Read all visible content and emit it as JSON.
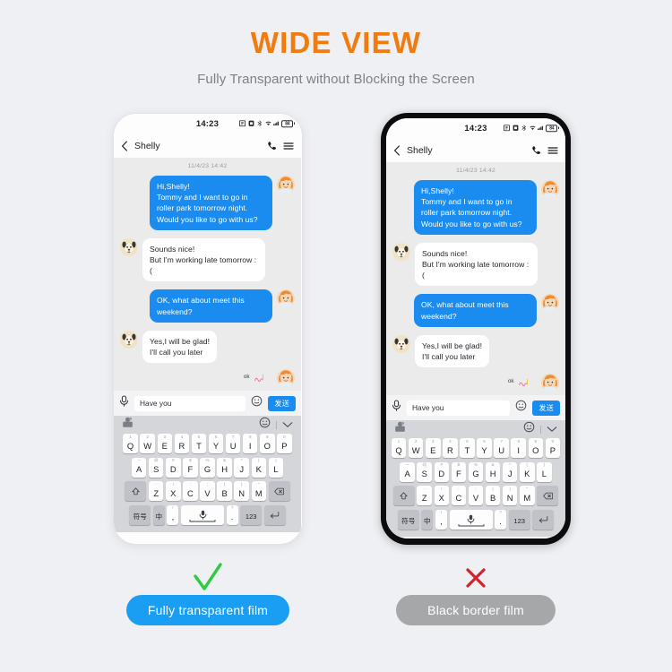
{
  "header": {
    "title": "WIDE VIEW",
    "subtitle": "Fully Transparent without Blocking the Screen",
    "title_color": "#f07c10",
    "subtitle_color": "#7d8089"
  },
  "phone": {
    "status_bar": {
      "time": "14:23",
      "battery_level": "84"
    },
    "chat_header": {
      "contact_name": "Shelly"
    },
    "chat": {
      "date_divider": "11/4/23 14:42",
      "messages": [
        {
          "side": "out",
          "text": "Hi,Shelly!\nTommy and I want to go in roller park tomorrow night. Would you like to go with us?"
        },
        {
          "side": "in",
          "text": "Sounds nice!\nBut I'm working late tomorrow :("
        },
        {
          "side": "out",
          "text": "OK, what about meet this weekend?"
        },
        {
          "side": "in",
          "text": "Yes,I will be glad!\nI'll call you later"
        }
      ],
      "sticker_label": "ok"
    },
    "input_bar": {
      "text_value": "Have you",
      "send_label": "发送",
      "mic_icon": "microphone-icon",
      "emoji_icon": "emoji-smile-icon"
    },
    "keyboard": {
      "toolbar": {
        "sticker_icon": "sticker-icon",
        "emoji_icon": "emoji-smile-icon",
        "collapse_icon": "chevron-down-icon"
      },
      "row1": [
        {
          "sup": "1",
          "main": "Q"
        },
        {
          "sup": "2",
          "main": "W"
        },
        {
          "sup": "3",
          "main": "E"
        },
        {
          "sup": "4",
          "main": "R"
        },
        {
          "sup": "5",
          "main": "T"
        },
        {
          "sup": "6",
          "main": "Y"
        },
        {
          "sup": "7",
          "main": "U"
        },
        {
          "sup": "8",
          "main": "I"
        },
        {
          "sup": "9",
          "main": "O"
        },
        {
          "sup": "0",
          "main": "P"
        }
      ],
      "row2": [
        {
          "sup": "~",
          "main": "A"
        },
        {
          "sup": "@",
          "main": "S"
        },
        {
          "sup": "#",
          "main": "D"
        },
        {
          "sup": "$",
          "main": "F"
        },
        {
          "sup": "%",
          "main": "G"
        },
        {
          "sup": "&",
          "main": "H"
        },
        {
          "sup": "*",
          "main": "J"
        },
        {
          "sup": "(",
          "main": "K"
        },
        {
          "sup": ")",
          "main": "L"
        }
      ],
      "row3": [
        {
          "sup": "-",
          "main": "Z"
        },
        {
          "sup": "/",
          "main": "X"
        },
        {
          "sup": ":",
          "main": "C"
        },
        {
          "sup": ";",
          "main": "V"
        },
        {
          "sup": "(",
          "main": "B"
        },
        {
          "sup": ")",
          "main": "N"
        },
        {
          "sup": "\"",
          "main": "M"
        }
      ],
      "shift_icon": "shift-arrow-icon",
      "backspace_icon": "backspace-icon",
      "row4": {
        "symbols_label": "符号",
        "lang_label": "中",
        "comma_sup": "!",
        "comma_main": ",",
        "space_icon": "microphone-icon",
        "period_sup": "?",
        "period_main": ".",
        "numbers_label": "123",
        "enter_icon": "enter-return-icon"
      }
    }
  },
  "verdicts": {
    "left": {
      "mark": "check-mark",
      "mark_color": "#2fcb3f",
      "label": "Fully transparent film",
      "pill_color": "#199ef3"
    },
    "right": {
      "mark": "cross-mark",
      "mark_color": "#d1252b",
      "label": "Black border film",
      "pill_color": "#a6a7a9"
    }
  }
}
